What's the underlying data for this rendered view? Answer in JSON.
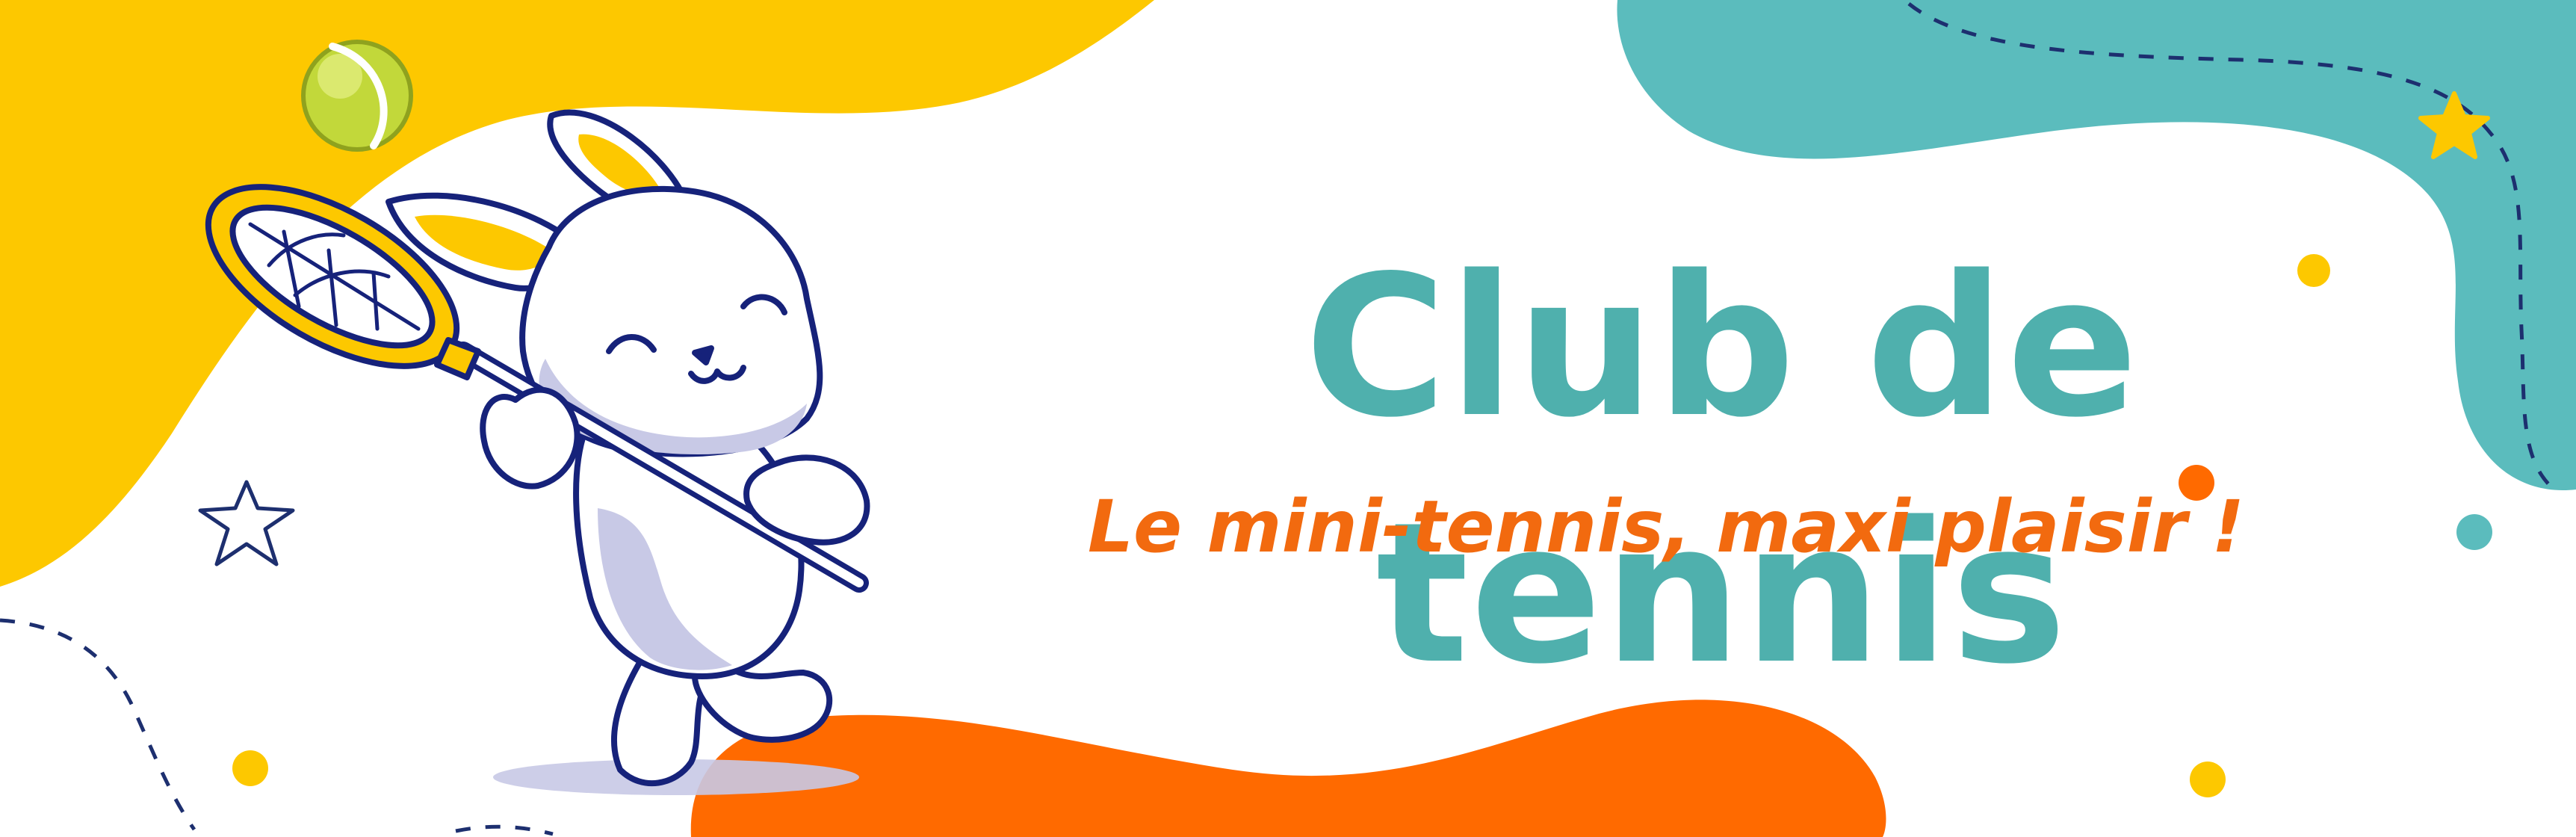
{
  "banner": {
    "title": "Club de tennis",
    "subtitle": "Le mini-tennis, maxi plaisir !"
  },
  "colors": {
    "title": "#4fb0ad",
    "subtitle": "#f26a0f",
    "blob_yellow": "#fdc800",
    "blob_teal": "#5bbcbd",
    "blob_orange": "#ff6a00",
    "outline_navy": "#16227a",
    "bunny_shade": "#c8c9e6"
  },
  "icons": [
    "tennis-ball-icon",
    "bunny-mascot-icon",
    "tennis-racket-icon",
    "star-icon"
  ]
}
